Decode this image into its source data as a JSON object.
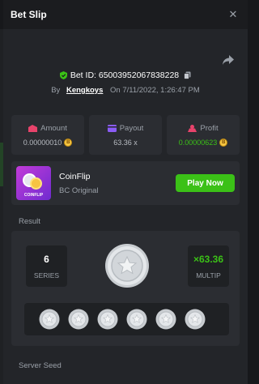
{
  "header": {
    "title": "Bet Slip",
    "close_icon": "close-icon"
  },
  "bet": {
    "id_label": "Bet ID: 65003952067838228",
    "by_label": "By",
    "user": "Kengkoys",
    "on_label": "On",
    "date": "7/11/2022, 1:26:47 PM"
  },
  "stats": [
    {
      "label": "Amount",
      "value": "0.00000010",
      "icon": "wallet-icon",
      "icon_color": "#e8436b",
      "has_coin": true,
      "green": false
    },
    {
      "label": "Payout",
      "value": "63.36 x",
      "icon": "payout-icon",
      "icon_color": "#8b5cf6",
      "has_coin": false,
      "green": false
    },
    {
      "label": "Profit",
      "value": "0.00000623",
      "icon": "profit-icon",
      "icon_color": "#e8436b",
      "has_coin": true,
      "green": true
    }
  ],
  "game": {
    "name": "CoinFlip",
    "subtitle": "BC Original",
    "thumb_label": "COINFLIP",
    "play_label": "Play Now"
  },
  "result": {
    "section_label": "Result",
    "series_value": "6",
    "series_label": "SERIES",
    "multiplier_value": "×63.36",
    "multiplier_label": "MULTIP"
  },
  "server_seed_label": "Server Seed",
  "colors": {
    "accent_green": "#3bc117",
    "panel": "#232529",
    "card": "#2b2d32"
  }
}
